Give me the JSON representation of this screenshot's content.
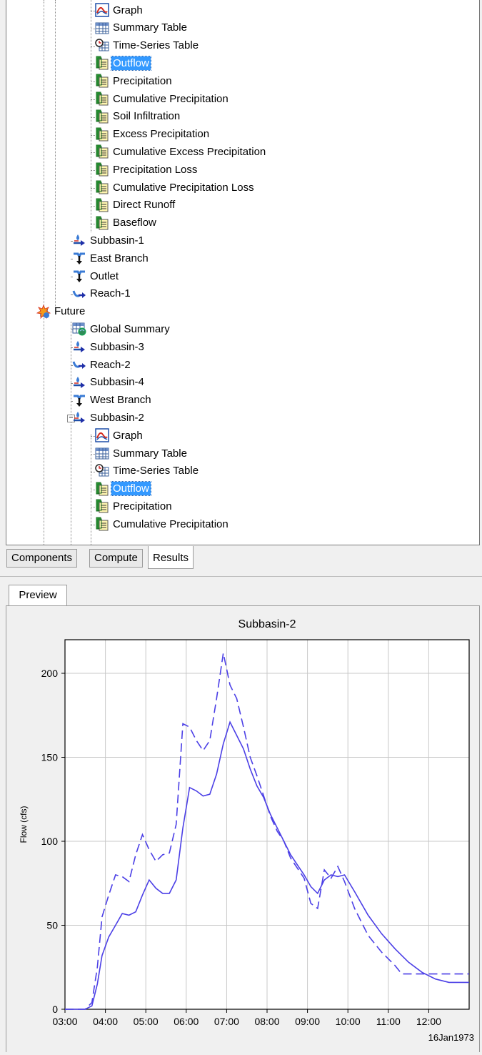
{
  "tree": {
    "items": [
      {
        "label": "Graph",
        "icon": "graph-icon",
        "depth": 3
      },
      {
        "label": "Summary Table",
        "icon": "table-icon",
        "depth": 3
      },
      {
        "label": "Time-Series Table",
        "icon": "clock-table-icon",
        "depth": 3
      },
      {
        "label": "Outflow",
        "icon": "timeseries-icon",
        "depth": 3,
        "selected": true
      },
      {
        "label": "Precipitation",
        "icon": "timeseries-icon",
        "depth": 3
      },
      {
        "label": "Cumulative Precipitation",
        "icon": "timeseries-icon",
        "depth": 3
      },
      {
        "label": "Soil Infiltration",
        "icon": "timeseries-icon",
        "depth": 3
      },
      {
        "label": "Excess Precipitation",
        "icon": "timeseries-icon",
        "depth": 3
      },
      {
        "label": "Cumulative Excess Precipitation",
        "icon": "timeseries-icon",
        "depth": 3
      },
      {
        "label": "Precipitation Loss",
        "icon": "timeseries-icon",
        "depth": 3
      },
      {
        "label": "Cumulative Precipitation Loss",
        "icon": "timeseries-icon",
        "depth": 3
      },
      {
        "label": "Direct Runoff",
        "icon": "timeseries-icon",
        "depth": 3
      },
      {
        "label": "Baseflow",
        "icon": "timeseries-icon",
        "depth": 3
      },
      {
        "label": "Subbasin-1",
        "icon": "subbasin-icon",
        "depth": 2
      },
      {
        "label": "East Branch",
        "icon": "junction-icon",
        "depth": 2
      },
      {
        "label": "Outlet",
        "icon": "junction-icon",
        "depth": 2
      },
      {
        "label": "Reach-1",
        "icon": "reach-icon",
        "depth": 2
      },
      {
        "label": "Future",
        "icon": "run-icon",
        "depth": 1,
        "expander": "−"
      },
      {
        "label": "Global Summary",
        "icon": "global-summary-icon",
        "depth": 2
      },
      {
        "label": "Subbasin-3",
        "icon": "subbasin-icon",
        "depth": 2
      },
      {
        "label": "Reach-2",
        "icon": "reach-icon",
        "depth": 2
      },
      {
        "label": "Subbasin-4",
        "icon": "subbasin-icon",
        "depth": 2
      },
      {
        "label": "West Branch",
        "icon": "junction-icon",
        "depth": 2
      },
      {
        "label": "Subbasin-2",
        "icon": "subbasin-icon",
        "depth": 2,
        "expander": "−"
      },
      {
        "label": "Graph",
        "icon": "graph-icon",
        "depth": 3
      },
      {
        "label": "Summary Table",
        "icon": "table-icon",
        "depth": 3
      },
      {
        "label": "Time-Series Table",
        "icon": "clock-table-icon",
        "depth": 3
      },
      {
        "label": "Outflow",
        "icon": "timeseries-icon",
        "depth": 3,
        "selected": true
      },
      {
        "label": "Precipitation",
        "icon": "timeseries-icon",
        "depth": 3
      },
      {
        "label": "Cumulative Precipitation",
        "icon": "timeseries-icon",
        "depth": 3
      }
    ]
  },
  "tabs": [
    {
      "label": "Components",
      "active": false
    },
    {
      "label": "Compute",
      "active": false
    },
    {
      "label": "Results",
      "active": true
    }
  ],
  "preview": {
    "tab_label": "Preview"
  },
  "chart_data": {
    "type": "line",
    "title": "Subbasin-2",
    "xlabel": "",
    "ylabel": "Flow (cfs)",
    "date_label": "16Jan1973",
    "x_ticks": [
      "03:00",
      "04:00",
      "05:00",
      "06:00",
      "07:00",
      "08:00",
      "09:00",
      "10:00",
      "11:00",
      "12:00"
    ],
    "y_ticks": [
      0,
      50,
      100,
      150,
      200
    ],
    "xlim": [
      "03:00",
      "13:00"
    ],
    "ylim": [
      0,
      220
    ],
    "grid": true,
    "legend": "none",
    "series": [
      {
        "style": "solid",
        "color": "#4b3fe6",
        "x": [
          "03:00",
          "03:30",
          "03:40",
          "03:48",
          "03:55",
          "04:05",
          "04:15",
          "04:25",
          "04:35",
          "04:45",
          "04:55",
          "05:05",
          "05:15",
          "05:25",
          "05:35",
          "05:45",
          "05:55",
          "06:05",
          "06:15",
          "06:25",
          "06:35",
          "06:45",
          "06:55",
          "07:05",
          "07:15",
          "07:25",
          "07:35",
          "07:45",
          "07:55",
          "08:05",
          "08:15",
          "08:25",
          "08:35",
          "08:45",
          "08:55",
          "09:05",
          "09:15",
          "09:25",
          "09:35",
          "09:45",
          "09:55",
          "10:10",
          "10:30",
          "10:50",
          "11:10",
          "11:30",
          "11:50",
          "12:10",
          "12:30",
          "13:00"
        ],
        "y": [
          0,
          0,
          2,
          15,
          32,
          43,
          50,
          57,
          56,
          58,
          68,
          77,
          72,
          69,
          69,
          77,
          108,
          132,
          130,
          127,
          128,
          140,
          158,
          171,
          163,
          155,
          143,
          133,
          126,
          116,
          108,
          100,
          92,
          86,
          80,
          73,
          69,
          77,
          80,
          79,
          80,
          70,
          56,
          45,
          36,
          28,
          22,
          18,
          16,
          16
        ]
      },
      {
        "style": "dashed",
        "color": "#4b3fe6",
        "x": [
          "03:00",
          "03:30",
          "03:40",
          "03:48",
          "03:55",
          "04:05",
          "04:15",
          "04:25",
          "04:35",
          "04:45",
          "04:55",
          "05:05",
          "05:15",
          "05:25",
          "05:35",
          "05:45",
          "05:55",
          "06:05",
          "06:15",
          "06:25",
          "06:35",
          "06:45",
          "06:55",
          "07:05",
          "07:15",
          "07:25",
          "07:35",
          "07:45",
          "07:55",
          "08:05",
          "08:15",
          "08:25",
          "08:35",
          "08:45",
          "08:55",
          "09:05",
          "09:15",
          "09:25",
          "09:35",
          "09:45",
          "09:55",
          "10:10",
          "10:30",
          "10:50",
          "11:10",
          "11:20",
          "11:40",
          "12:00",
          "12:30",
          "13:00"
        ],
        "y": [
          0,
          0,
          4,
          25,
          55,
          68,
          80,
          79,
          76,
          92,
          104,
          95,
          88,
          92,
          93,
          110,
          170,
          168,
          160,
          154,
          160,
          185,
          212,
          193,
          185,
          168,
          150,
          139,
          127,
          115,
          106,
          100,
          90,
          84,
          78,
          63,
          60,
          83,
          78,
          85,
          76,
          60,
          44,
          34,
          26,
          21,
          21,
          21,
          21,
          21
        ]
      }
    ]
  }
}
